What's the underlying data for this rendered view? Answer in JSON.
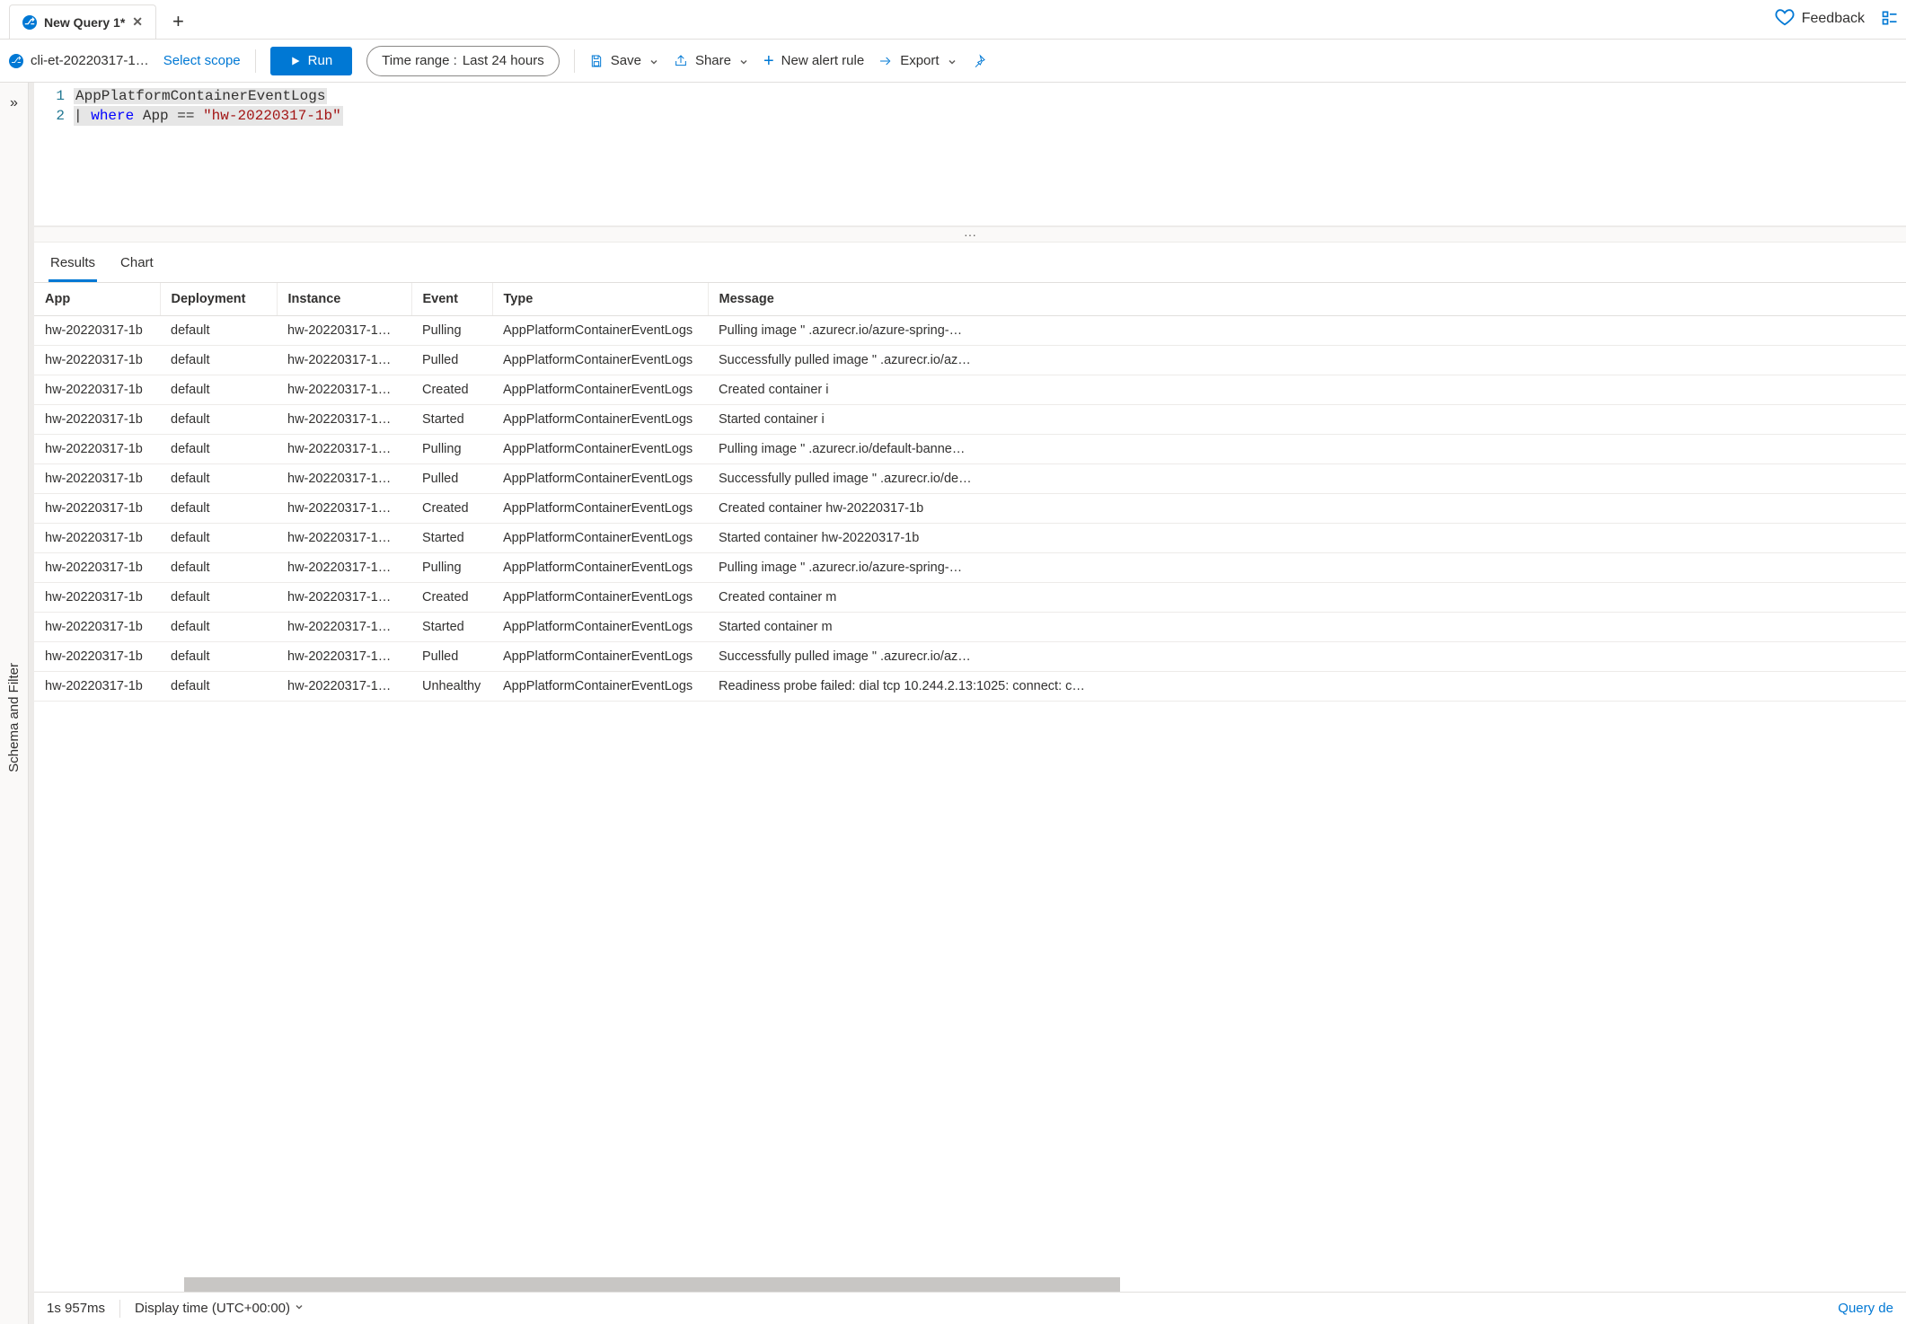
{
  "header": {
    "tab_title": "New Query 1*",
    "feedback_label": "Feedback"
  },
  "toolbar": {
    "source_label": "cli-et-20220317-1…",
    "scope_label": "Select scope",
    "run_label": "Run",
    "timerange_label": "Time range :",
    "timerange_value": "Last 24 hours",
    "save_label": "Save",
    "share_label": "Share",
    "new_alert_label": "New alert rule",
    "export_label": "Export"
  },
  "sidebar": {
    "label": "Schema and Filter"
  },
  "editor": {
    "lines": [
      {
        "n": "1"
      },
      {
        "n": "2"
      }
    ],
    "code": {
      "l1_table": "AppPlatformContainerEventLogs",
      "l2_pipe": "|",
      "l2_where": "where",
      "l2_field": "App",
      "l2_op": "==",
      "l2_str": "\"hw-20220317-1b\""
    }
  },
  "result_tabs": {
    "results": "Results",
    "chart": "Chart"
  },
  "columns": {
    "app": "App",
    "deployment": "Deployment",
    "instance": "Instance",
    "event": "Event",
    "type": "Type",
    "message": "Message"
  },
  "rows": [
    {
      "app": "hw-20220317-1b",
      "deployment": "default",
      "instance": "hw-20220317-1…",
      "event": "Pulling",
      "type": "AppPlatformContainerEventLogs",
      "message": "Pulling image \"                                      .azurecr.io/azure-spring-…"
    },
    {
      "app": "hw-20220317-1b",
      "deployment": "default",
      "instance": "hw-20220317-1…",
      "event": "Pulled",
      "type": "AppPlatformContainerEventLogs",
      "message": "Successfully pulled image \"                                      .azurecr.io/az…"
    },
    {
      "app": "hw-20220317-1b",
      "deployment": "default",
      "instance": "hw-20220317-1…",
      "event": "Created",
      "type": "AppPlatformContainerEventLogs",
      "message": "Created container i"
    },
    {
      "app": "hw-20220317-1b",
      "deployment": "default",
      "instance": "hw-20220317-1…",
      "event": "Started",
      "type": "AppPlatformContainerEventLogs",
      "message": "Started container i"
    },
    {
      "app": "hw-20220317-1b",
      "deployment": "default",
      "instance": "hw-20220317-1…",
      "event": "Pulling",
      "type": "AppPlatformContainerEventLogs",
      "message": "Pulling image \"                                      .azurecr.io/default-banne…"
    },
    {
      "app": "hw-20220317-1b",
      "deployment": "default",
      "instance": "hw-20220317-1…",
      "event": "Pulled",
      "type": "AppPlatformContainerEventLogs",
      "message": "Successfully pulled image \"                                      .azurecr.io/de…"
    },
    {
      "app": "hw-20220317-1b",
      "deployment": "default",
      "instance": "hw-20220317-1…",
      "event": "Created",
      "type": "AppPlatformContainerEventLogs",
      "message": "Created container hw-20220317-1b"
    },
    {
      "app": "hw-20220317-1b",
      "deployment": "default",
      "instance": "hw-20220317-1…",
      "event": "Started",
      "type": "AppPlatformContainerEventLogs",
      "message": "Started container hw-20220317-1b"
    },
    {
      "app": "hw-20220317-1b",
      "deployment": "default",
      "instance": "hw-20220317-1…",
      "event": "Pulling",
      "type": "AppPlatformContainerEventLogs",
      "message": "Pulling image \"                                      .azurecr.io/azure-spring-…"
    },
    {
      "app": "hw-20220317-1b",
      "deployment": "default",
      "instance": "hw-20220317-1…",
      "event": "Created",
      "type": "AppPlatformContainerEventLogs",
      "message": "Created container m"
    },
    {
      "app": "hw-20220317-1b",
      "deployment": "default",
      "instance": "hw-20220317-1…",
      "event": "Started",
      "type": "AppPlatformContainerEventLogs",
      "message": "Started container m"
    },
    {
      "app": "hw-20220317-1b",
      "deployment": "default",
      "instance": "hw-20220317-1…",
      "event": "Pulled",
      "type": "AppPlatformContainerEventLogs",
      "message": "Successfully pulled image \"                                      .azurecr.io/az…"
    },
    {
      "app": "hw-20220317-1b",
      "deployment": "default",
      "instance": "hw-20220317-1…",
      "event": "Unhealthy",
      "type": "AppPlatformContainerEventLogs",
      "message": "Readiness probe failed: dial tcp 10.244.2.13:1025: connect: c…"
    }
  ],
  "status": {
    "duration": "1s 957ms",
    "display_time": "Display time (UTC+00:00)",
    "query_details": "Query de"
  }
}
